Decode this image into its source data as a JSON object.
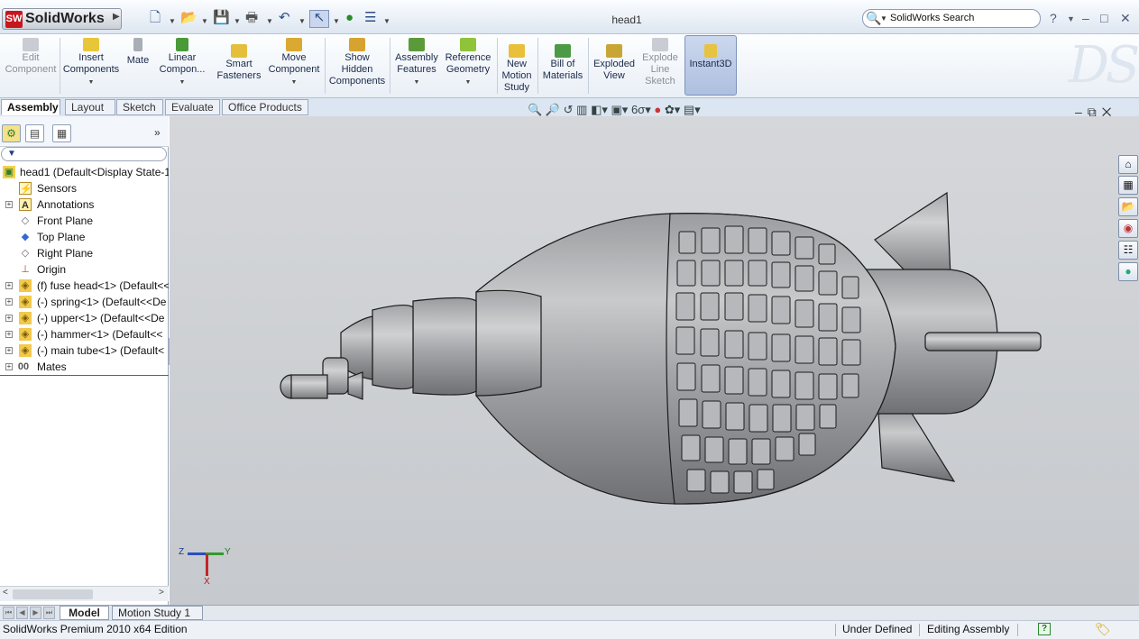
{
  "app": {
    "name": "SolidWorks",
    "document_title": "head1"
  },
  "quick_access": {
    "icons": [
      "new-document-icon",
      "open-folder-icon",
      "save-icon",
      "print-icon",
      "undo-icon",
      "select-arrow-icon",
      "rebuild-icon",
      "options-icon"
    ]
  },
  "search": {
    "placeholder": "SolidWorks Search"
  },
  "window_controls": {
    "help": "?",
    "minimize": "–",
    "restore": "□",
    "close": "✕"
  },
  "command_manager": {
    "tools": [
      {
        "id": "edit-component",
        "label": [
          "Edit",
          "Component"
        ],
        "icon": "edit-component-icon",
        "disabled": true
      },
      {
        "id": "insert-components",
        "label": [
          "Insert",
          "Components"
        ],
        "icon": "insert-components-icon",
        "dropdown": true
      },
      {
        "id": "mate",
        "label": [
          "Mate"
        ],
        "icon": "mate-paperclip-icon"
      },
      {
        "id": "linear-component",
        "label": [
          "Linear",
          "Compon..."
        ],
        "icon": "linear-pattern-icon",
        "dropdown": true
      },
      {
        "id": "smart-fasteners",
        "label": [
          "Smart",
          "Fasteners"
        ],
        "icon": "smart-fasteners-icon"
      },
      {
        "id": "move-component",
        "label": [
          "Move",
          "Component"
        ],
        "icon": "move-component-icon",
        "dropdown": true
      },
      {
        "id": "show-hidden-components",
        "label": [
          "Show",
          "Hidden",
          "Components"
        ],
        "icon": "show-hidden-icon"
      },
      {
        "id": "assembly-features",
        "label": [
          "Assembly",
          "Features"
        ],
        "icon": "assembly-features-icon",
        "dropdown": true
      },
      {
        "id": "reference-geometry",
        "label": [
          "Reference",
          "Geometry"
        ],
        "icon": "reference-geometry-icon",
        "dropdown": true
      },
      {
        "id": "new-motion-study",
        "label": [
          "New",
          "Motion",
          "Study"
        ],
        "icon": "motion-study-icon"
      },
      {
        "id": "bill-of-materials",
        "label": [
          "Bill of",
          "Materials"
        ],
        "icon": "bill-of-materials-icon"
      },
      {
        "id": "exploded-view",
        "label": [
          "Exploded",
          "View"
        ],
        "icon": "exploded-view-icon"
      },
      {
        "id": "explode-line-sketch",
        "label": [
          "Explode",
          "Line",
          "Sketch"
        ],
        "icon": "explode-line-icon",
        "disabled": true
      },
      {
        "id": "instant3d",
        "label": [
          "Instant3D"
        ],
        "icon": "instant3d-icon",
        "active": true
      }
    ]
  },
  "tabs": [
    "Assembly",
    "Layout",
    "Sketch",
    "Evaluate",
    "Office Products"
  ],
  "active_tab": "Assembly",
  "feature_tree": {
    "more": "»",
    "filter": "▼",
    "items": [
      {
        "label": "head1  (Default<Display State-1",
        "icon": "assembly-icon"
      },
      {
        "label": "Sensors",
        "icon": "sensor-icon"
      },
      {
        "label": "Annotations",
        "icon": "annotations-icon",
        "expandable": true
      },
      {
        "label": "Front Plane",
        "icon": "plane-icon"
      },
      {
        "label": "Top Plane",
        "icon": "plane-icon"
      },
      {
        "label": "Right Plane",
        "icon": "plane-icon"
      },
      {
        "label": "Origin",
        "icon": "origin-icon"
      },
      {
        "label": "(f) fuse head<1> (Default<<",
        "icon": "part-icon",
        "expandable": true
      },
      {
        "label": "(-) spring<1> (Default<<De",
        "icon": "part-icon",
        "expandable": true
      },
      {
        "label": "(-) upper<1> (Default<<De",
        "icon": "part-icon",
        "expandable": true
      },
      {
        "label": "(-) hammer<1> (Default<<",
        "icon": "part-icon",
        "expandable": true
      },
      {
        "label": "(-) main tube<1> (Default<",
        "icon": "part-icon",
        "expandable": true
      },
      {
        "label": "Mates",
        "icon": "mates-icon",
        "expandable": true
      }
    ]
  },
  "triad": {
    "z": "Z",
    "y": "Y",
    "x": "X"
  },
  "bottom_tabs": [
    "Model",
    "Motion Study 1"
  ],
  "status": {
    "edition": "SolidWorks Premium 2010 x64 Edition",
    "definition": "Under Defined",
    "mode": "Editing Assembly"
  }
}
